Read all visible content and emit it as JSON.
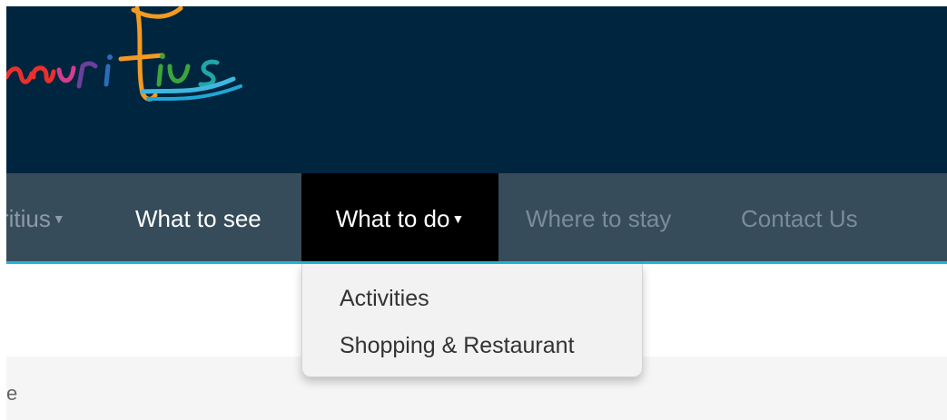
{
  "logo": {
    "text": "Mauritius"
  },
  "nav": {
    "items": [
      {
        "label": "ritius",
        "has_dropdown": true,
        "state": "inactive"
      },
      {
        "label": "What to see",
        "has_dropdown": false,
        "state": "active"
      },
      {
        "label": "What to do",
        "has_dropdown": true,
        "state": "open"
      },
      {
        "label": "Where to stay",
        "has_dropdown": false,
        "state": "inactive"
      },
      {
        "label": "Contact Us",
        "has_dropdown": false,
        "state": "inactive"
      }
    ]
  },
  "dropdown": {
    "items": [
      {
        "label": "Activities"
      },
      {
        "label": "Shopping & Restaurant"
      }
    ]
  },
  "content": {
    "text": "e"
  },
  "colors": {
    "header_bg": "#00253f",
    "nav_bg": "#364c5b",
    "nav_active_bg": "#000000",
    "nav_accent": "#22b5d8",
    "dropdown_bg": "#f2f2f2"
  },
  "icons": {
    "caret": "caret-down-icon"
  }
}
